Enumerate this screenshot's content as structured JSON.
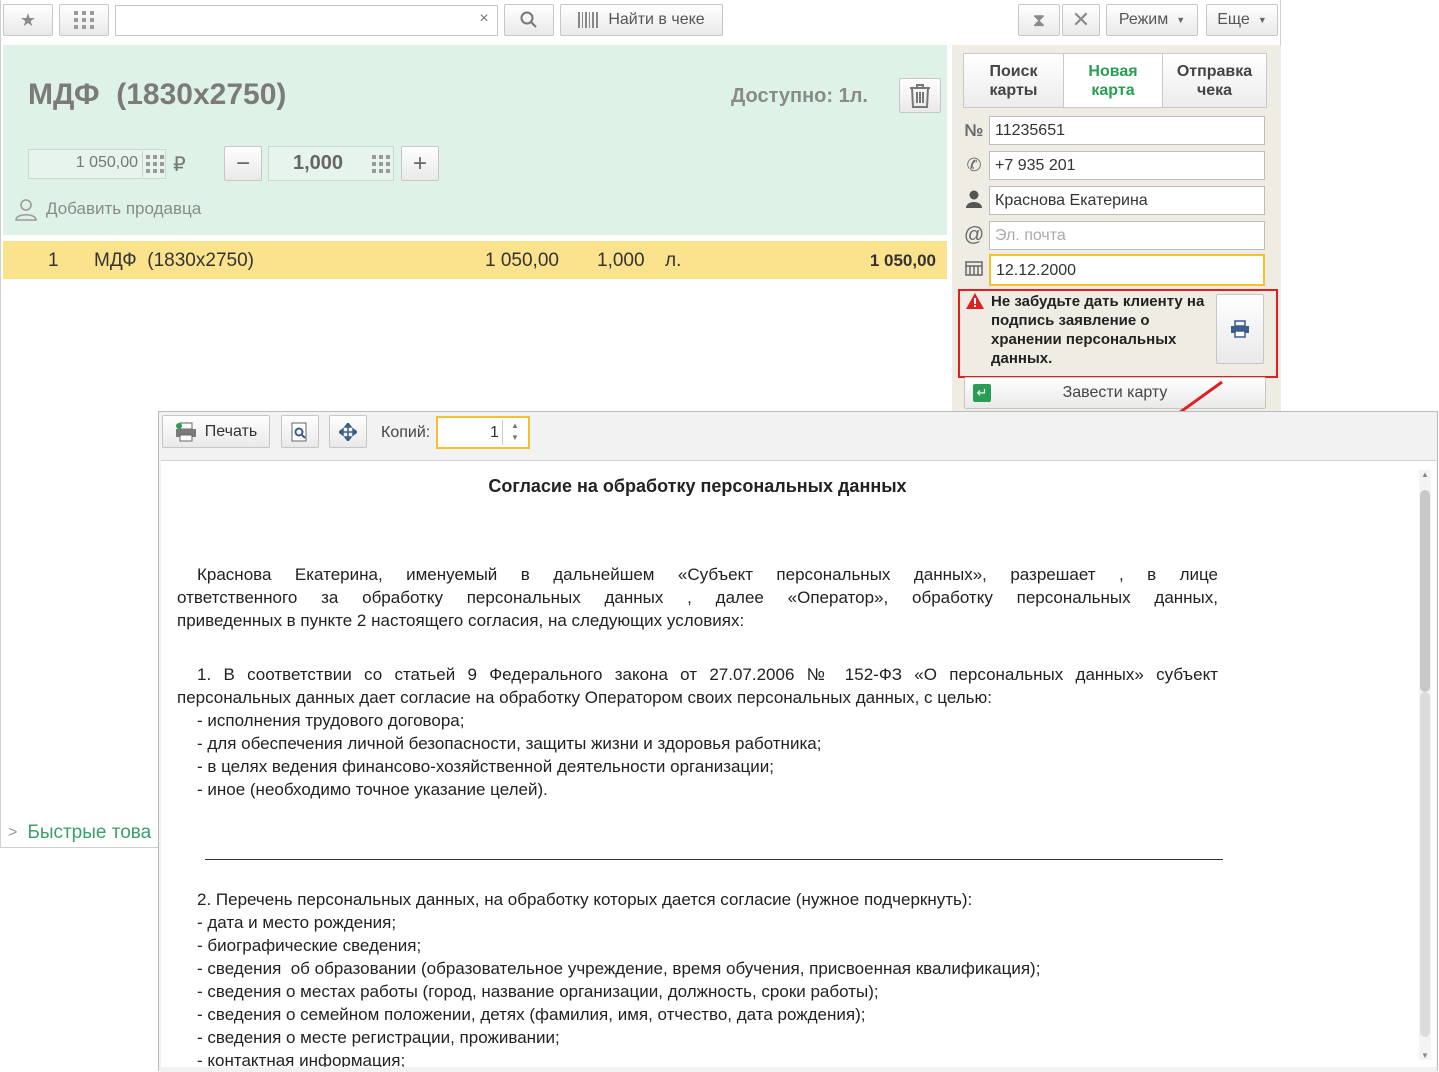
{
  "toolbar": {
    "find_in_receipt": "Найти в чеке",
    "mode": "Режим",
    "more": "Еще"
  },
  "product": {
    "name": "МДФ  (1830х2750)",
    "available": "Доступно: 1л.",
    "price": "1 050,00",
    "currency": "₽",
    "quantity": "1,000",
    "add_seller": "Добавить продавца"
  },
  "sale_row": {
    "num": "1",
    "name": "МДФ  (1830х2750)",
    "price": "1 050,00",
    "qty": "1,000",
    "unit": "л.",
    "total": "1 050,00"
  },
  "quick_goods": "Быстрые това",
  "card": {
    "tabs": [
      "Поиск\nкарты",
      "Новая\nкарта",
      "Отправка\nчека"
    ],
    "number": "11235651",
    "phone": "+7 935 201",
    "name": "Краснова Екатерина",
    "email_placeholder": "Эл. почта",
    "birthdate": "12.12.2000",
    "notice": "Не забудьте дать клиенту на подпись заявление о хранении персональных данных.",
    "create_card": "Завести карту"
  },
  "preview": {
    "print": "Печать",
    "copies_label": "Копий:",
    "copies": "1"
  },
  "document": {
    "title": "Согласие на обработку персональных данных",
    "para1": [
      "Краснова Екатерина, именуемый в дальнейшем «Субъект персональных данных», разрешает , в лице",
      "ответственного за обработку персональных данных , далее «Оператор», обработку персональных данных,",
      "приведенных в пункте 2 настоящего согласия, на следующих условиях:"
    ],
    "para2": [
      "1. В соответствии со статьей 9 Федерального закона от 27.07.2006 № 152-ФЗ «О персональных данных» субъект",
      "персональных данных дает согласие на обработку Оператором своих персональных данных, с целью:",
      "- исполнения трудового договора;",
      "- для обеспечения личной безопасности, защиты жизни и здоровья работника;",
      "- в целях ведения финансово-хозяйственной деятельности организации;",
      "- иное (необходимо точное указание целей)."
    ],
    "para3": [
      "2. Перечень персональных данных, на обработку которых дается согласие (нужное подчеркнуть):",
      "- дата и место рождения;",
      "- биографические сведения;",
      "- сведения  об образовании (образовательное учреждение, время обучения, присвоенная квалификация);",
      "- сведения о местах работы (город, название организации, должность, сроки работы);",
      "- сведения о семейном положении, детях (фамилия, имя, отчество, дата рождения);",
      "- сведения о месте регистрации, проживании;",
      "- контактная информация;"
    ]
  },
  "colors": {
    "panel_green": "#def2e8",
    "row_yellow": "#fbe38e",
    "accent_green": "#2a9d55",
    "alert_red": "#e02020",
    "notice_bg": "#efece3"
  }
}
